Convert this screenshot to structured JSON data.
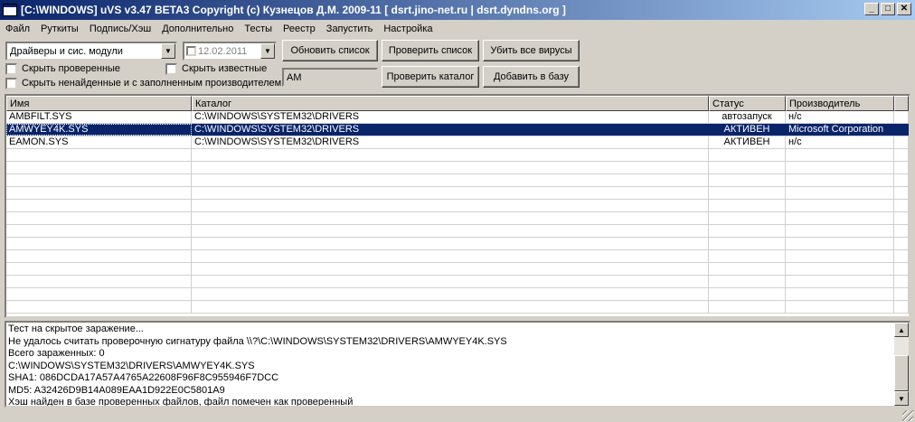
{
  "window": {
    "title": "[C:\\WINDOWS] uVS v3.47 BETA3 Copyright (c) Кузнецов Д.М. 2009-11 [ dsrt.jino-net.ru | dsrt.dyndns.org ]",
    "minimize_label": "_",
    "maximize_label": "□",
    "close_label": "✕"
  },
  "menu": [
    "Файл",
    "Руткиты",
    "Подпись/Хэш",
    "Дополнительно",
    "Тесты",
    "Реестр",
    "Запустить",
    "Настройка"
  ],
  "toolbar": {
    "category_select": "Драйверы и сис. модули",
    "date_value": "12.02.2011",
    "filter_value": "AM",
    "buttons": {
      "refresh": "Обновить список",
      "check_list": "Проверить список",
      "kill_viruses": "Убить все вирусы",
      "check_dir": "Проверить каталог",
      "add_db": "Добавить в базу"
    },
    "checkboxes": {
      "hide_checked": "Скрыть проверенные",
      "hide_known": "Скрыть известные",
      "hide_notfound": "Скрыть ненайденные и с заполненным производителем"
    }
  },
  "table": {
    "columns": [
      "Имя",
      "Каталог",
      "Статус",
      "Производитель"
    ],
    "rows": [
      {
        "name": "AMBFILT.SYS",
        "dir": "C:\\WINDOWS\\SYSTEM32\\DRIVERS",
        "status": "автозапуск",
        "vendor": "н/с"
      },
      {
        "name": "AMWYEY4K.SYS",
        "dir": "C:\\WINDOWS\\SYSTEM32\\DRIVERS",
        "status": "АКТИВЕН",
        "vendor": "Microsoft Corporation"
      },
      {
        "name": "EAMON.SYS",
        "dir": "C:\\WINDOWS\\SYSTEM32\\DRIVERS",
        "status": "АКТИВЕН",
        "vendor": "н/с"
      }
    ],
    "selected_index": 1
  },
  "log": [
    "Тест на скрытое заражение...",
    "Не удалось считать проверочную сигнатуру файла \\\\?\\C:\\WINDOWS\\SYSTEM32\\DRIVERS\\AMWYEY4K.SYS",
    "Всего зараженных: 0",
    "C:\\WINDOWS\\SYSTEM32\\DRIVERS\\AMWYEY4K.SYS",
    "SHA1: 086DCDA17A57A4765A22608F96F8C955946F7DCC",
    "MD5: A32426D9B14A089EAA1D922E0C5801A9",
    "Хэш найден в базе проверенных файлов, файл помечен как проверенный"
  ],
  "colors": {
    "face": "#d4d0c8",
    "title_start": "#0a246a",
    "title_end": "#a6caf0",
    "selection": "#0a246a"
  }
}
